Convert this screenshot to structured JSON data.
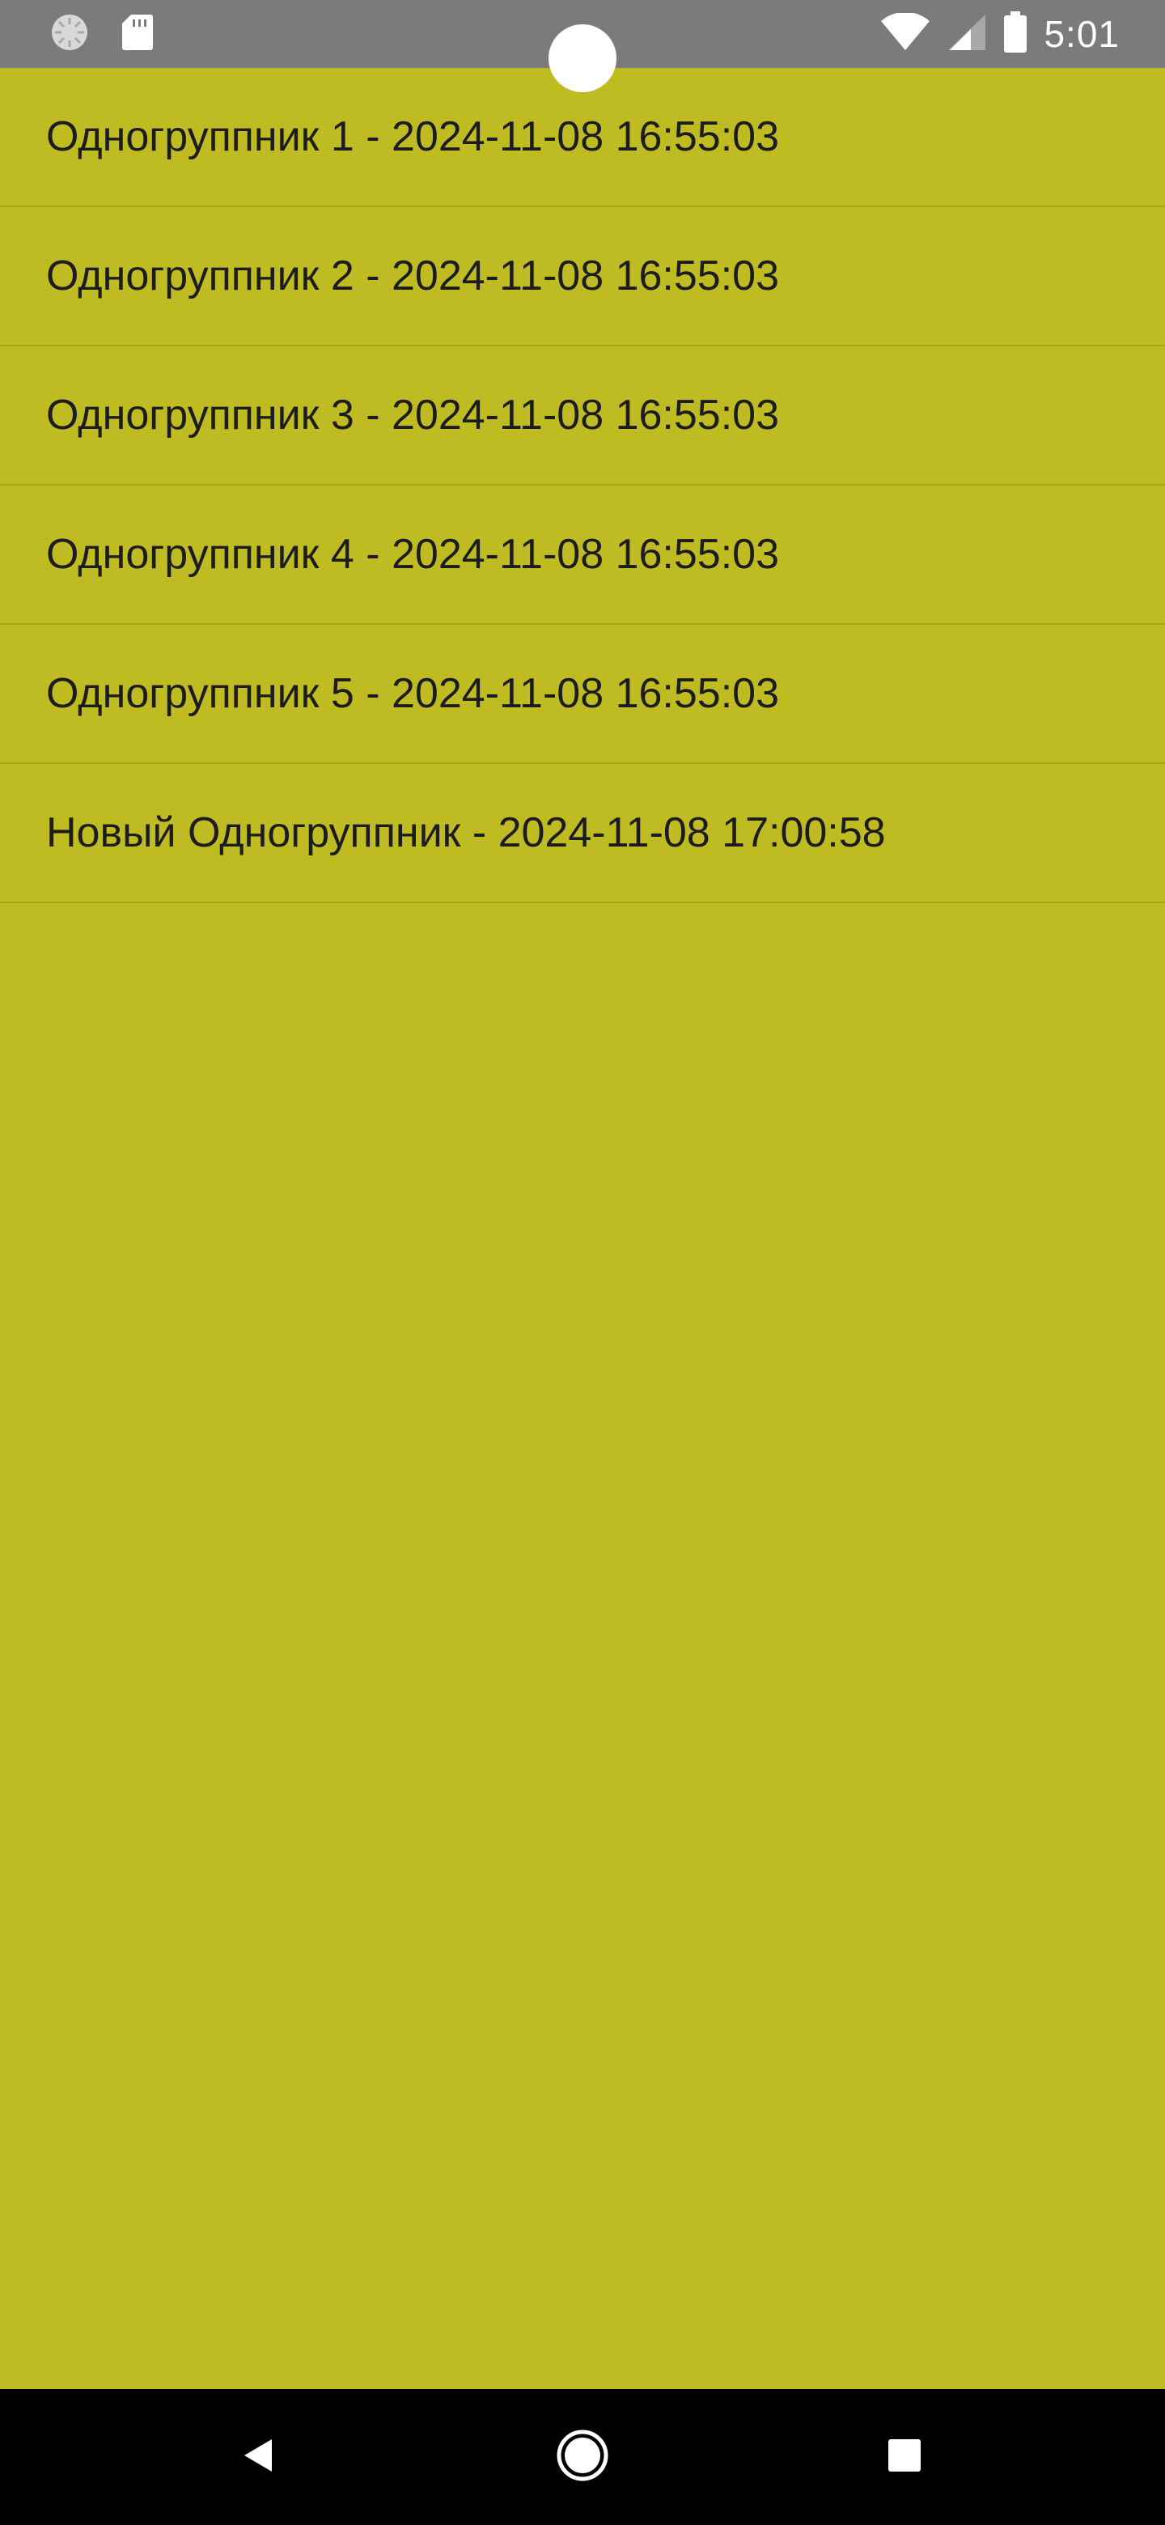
{
  "status_bar": {
    "time": "5:01",
    "left_icons": [
      "sync-icon",
      "sd-card-icon"
    ],
    "right_icons": [
      "wifi-icon",
      "cell-signal-icon",
      "battery-icon"
    ]
  },
  "list": {
    "items": [
      {
        "label": "Одногруппник 1 - 2024-11-08 16:55:03"
      },
      {
        "label": "Одногруппник 2 - 2024-11-08 16:55:03"
      },
      {
        "label": "Одногруппник 3 - 2024-11-08 16:55:03"
      },
      {
        "label": "Одногруппник 4 - 2024-11-08 16:55:03"
      },
      {
        "label": "Одногруппник 5 - 2024-11-08 16:55:03"
      },
      {
        "label": "Новый Одногруппник - 2024-11-08 17:00:58"
      }
    ]
  },
  "nav_bar": {
    "buttons": [
      "back-icon",
      "home-icon",
      "recents-icon"
    ]
  },
  "colors": {
    "background": "#bfbb22",
    "status_bar": "#7b7b7b",
    "divider": "#a8a41c",
    "nav_bar": "#000000",
    "text": "#1c1c1c"
  }
}
